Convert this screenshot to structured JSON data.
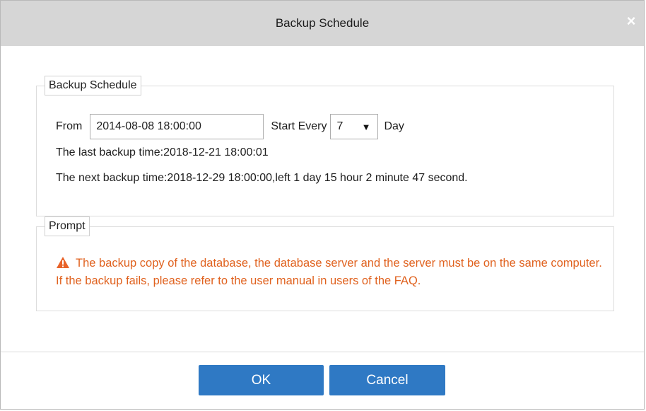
{
  "dialog": {
    "title": "Backup Schedule",
    "close_glyph": "×"
  },
  "schedule": {
    "legend": "Backup Schedule",
    "from_label": "From",
    "from_value": "2014-08-08 18:00:00",
    "start_every_label": "Start Every",
    "interval_value": "7",
    "unit_label": "Day",
    "last_backup": "The last backup time:2018-12-21 18:00:01",
    "next_backup": "The next backup time:2018-12-29 18:00:00,left 1 day 15 hour 2 minute 47 second."
  },
  "prompt": {
    "legend": "Prompt",
    "icon": "warning-icon",
    "text": "The backup copy of the database, the database server and the server must be on the same computer. If the backup fails, please refer to the user manual in users of the FAQ."
  },
  "footer": {
    "ok_label": "OK",
    "cancel_label": "Cancel"
  },
  "colors": {
    "accent": "#2f79c4",
    "warning_text": "#e0621f",
    "warning_icon": "#e8632a",
    "titlebar": "#d6d6d6"
  }
}
